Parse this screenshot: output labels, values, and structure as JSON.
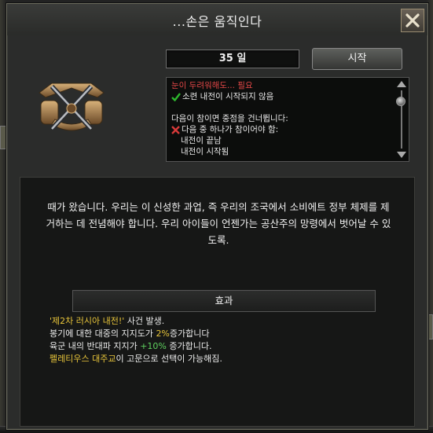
{
  "window": {
    "title": "...손은 움직인다",
    "close_label": ""
  },
  "decision": {
    "days": "35 일",
    "start_label": "시작"
  },
  "conditions": {
    "warning": "눈이 두려워해도... 필요",
    "check_item": "소련 내전이 시작되지 않음",
    "skip_line": "다음이 참이면 중점을 건너뜁니다:",
    "any_true": "다음 중 하나가 참이어야 함:",
    "sub1": "내전이 끝남",
    "sub2": "내전이 시작됨"
  },
  "description": "때가 왔습니다. 우리는 이 신성한 과업, 즉 우리의 조국에서 소비에트 정부 체제를 제거하는 데 전념해야 합니다. 우리 아이들이 언젠가는 공산주의 망령에서 벗어날 수 있도록.",
  "effects_header": "효과",
  "effects": {
    "line1_event": "'제2차 러시아 내전!'",
    "line1_rest": " 사건 발생.",
    "line2_pre": "봉기에 대한 대중의 지지도가 ",
    "line2_val": "2%",
    "line2_post": "증가합니다",
    "line3_pre": "육군 내의 반대파 지지가 ",
    "line3_val": "+10%",
    "line3_post": " 증가합니다.",
    "line4_name": "펠레티우스 대주교",
    "line4_rest": "이 고문으로 선택이 가능해짐."
  },
  "colors": {
    "warning": "#e04646",
    "highlight": "#e8c53a",
    "positive": "#5fd15f",
    "check": "#2eb82e",
    "cross": "#d83a3a"
  },
  "icons": [
    "crossed-swords-emblem-icon",
    "checkmark-icon",
    "cross-icon",
    "close-icon",
    "scroll-up-icon",
    "scroll-down-icon"
  ]
}
